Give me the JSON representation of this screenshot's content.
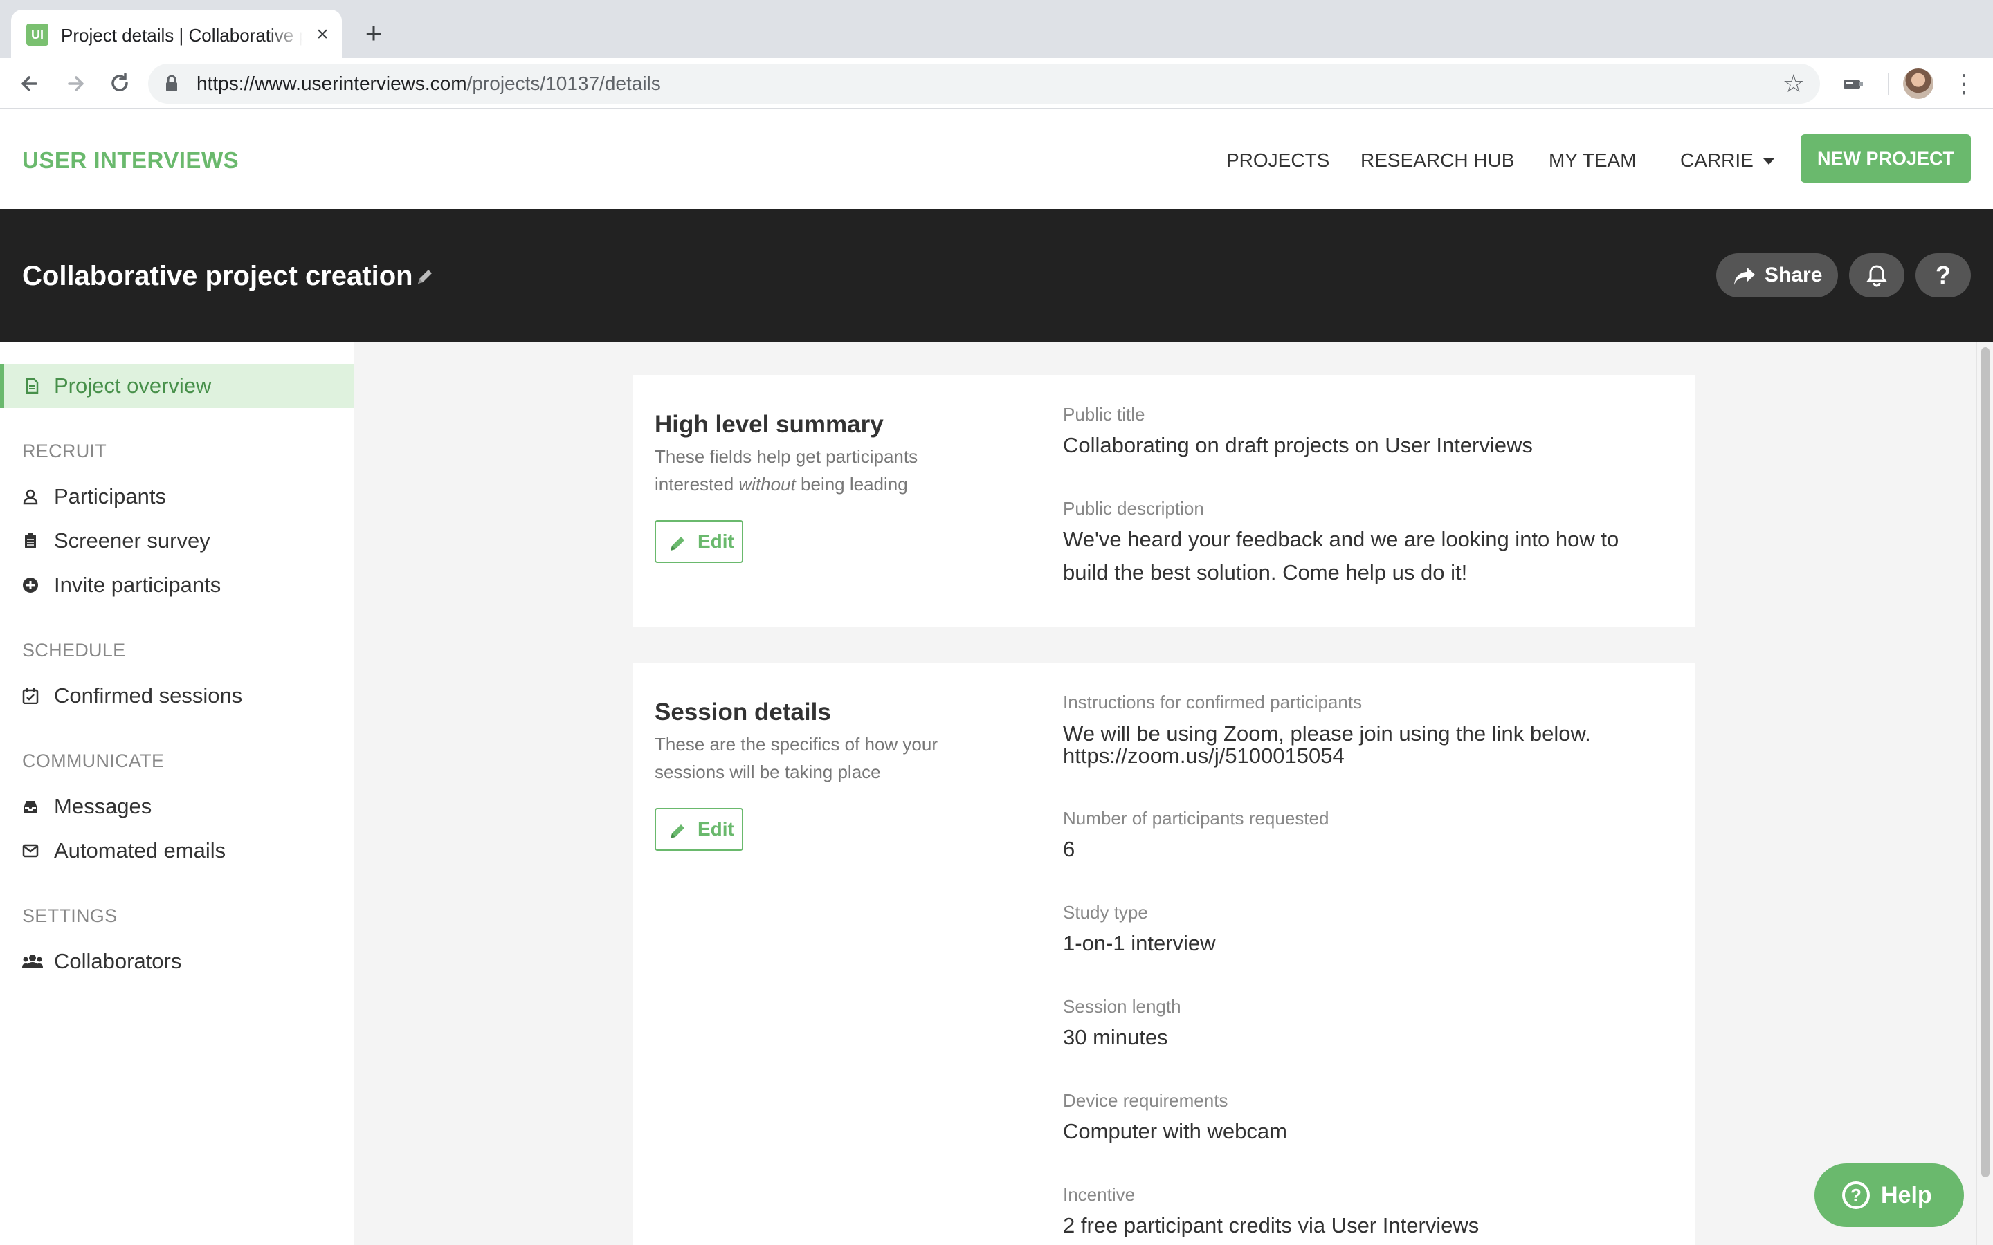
{
  "browser": {
    "tab_title": "Project details | Collaborative project creation",
    "tab_favicon": "UI",
    "tab_close": "×",
    "new_tab": "+",
    "url_domain": "https://www.userinterviews.com",
    "url_path": "/projects/10137/details",
    "icons": [
      "back-arrow-icon",
      "forward-arrow-icon",
      "reload-icon",
      "lock-icon",
      "star-icon",
      "extension-icon",
      "profile-avatar",
      "more-menu-icon"
    ]
  },
  "header": {
    "brand": "USER INTERVIEWS",
    "nav": {
      "projects": "PROJECTS",
      "research_hub": "RESEARCH HUB",
      "my_team": "MY TEAM",
      "user": "CARRIE"
    },
    "new_project_label": "NEW PROJECT"
  },
  "banner": {
    "title": "Collaborative project creation",
    "share_label": "Share",
    "help_symbol": "?"
  },
  "sidebar": {
    "overview": "Project overview",
    "recruit_heading": "RECRUIT",
    "participants": "Participants",
    "screener_survey": "Screener survey",
    "invite_participants": "Invite participants",
    "schedule_heading": "SCHEDULE",
    "confirmed_sessions": "Confirmed sessions",
    "communicate_heading": "COMMUNICATE",
    "messages": "Messages",
    "automated_emails": "Automated emails",
    "settings_heading": "SETTINGS",
    "collaborators": "Collaborators"
  },
  "summary_card": {
    "title": "High level summary",
    "desc_before": "These fields help get participants interested ",
    "desc_em": "without",
    "desc_after": " being leading",
    "edit_label": "Edit",
    "public_title_label": "Public title",
    "public_title_value": "Collaborating on draft projects on User Interviews",
    "public_description_label": "Public description",
    "public_description_value": "We've heard your feedback and we are looking into how to build the best solution. Come help us do it!"
  },
  "session_card": {
    "title": "Session details",
    "desc": "These are the specifics of how your sessions will be taking place",
    "edit_label": "Edit",
    "instructions_label": "Instructions for confirmed participants",
    "instructions_line1": "We will be using Zoom, please join using the link below.",
    "instructions_line2": "https://zoom.us/j/5100015054",
    "participants_label": "Number of participants requested",
    "participants_value": "6",
    "study_type_label": "Study type",
    "study_type_value": "1-on-1 interview",
    "session_length_label": "Session length",
    "session_length_value": "30 minutes",
    "device_label": "Device requirements",
    "device_value": "Computer with webcam",
    "incentive_label": "Incentive",
    "incentive_value": "2 free participant credits via User Interviews"
  },
  "help_widget": {
    "label": "Help",
    "symbol": "?"
  },
  "colors": {
    "brand_green": "#6ab96d",
    "banner_dark": "#222222",
    "active_bg": "#dff2de"
  }
}
